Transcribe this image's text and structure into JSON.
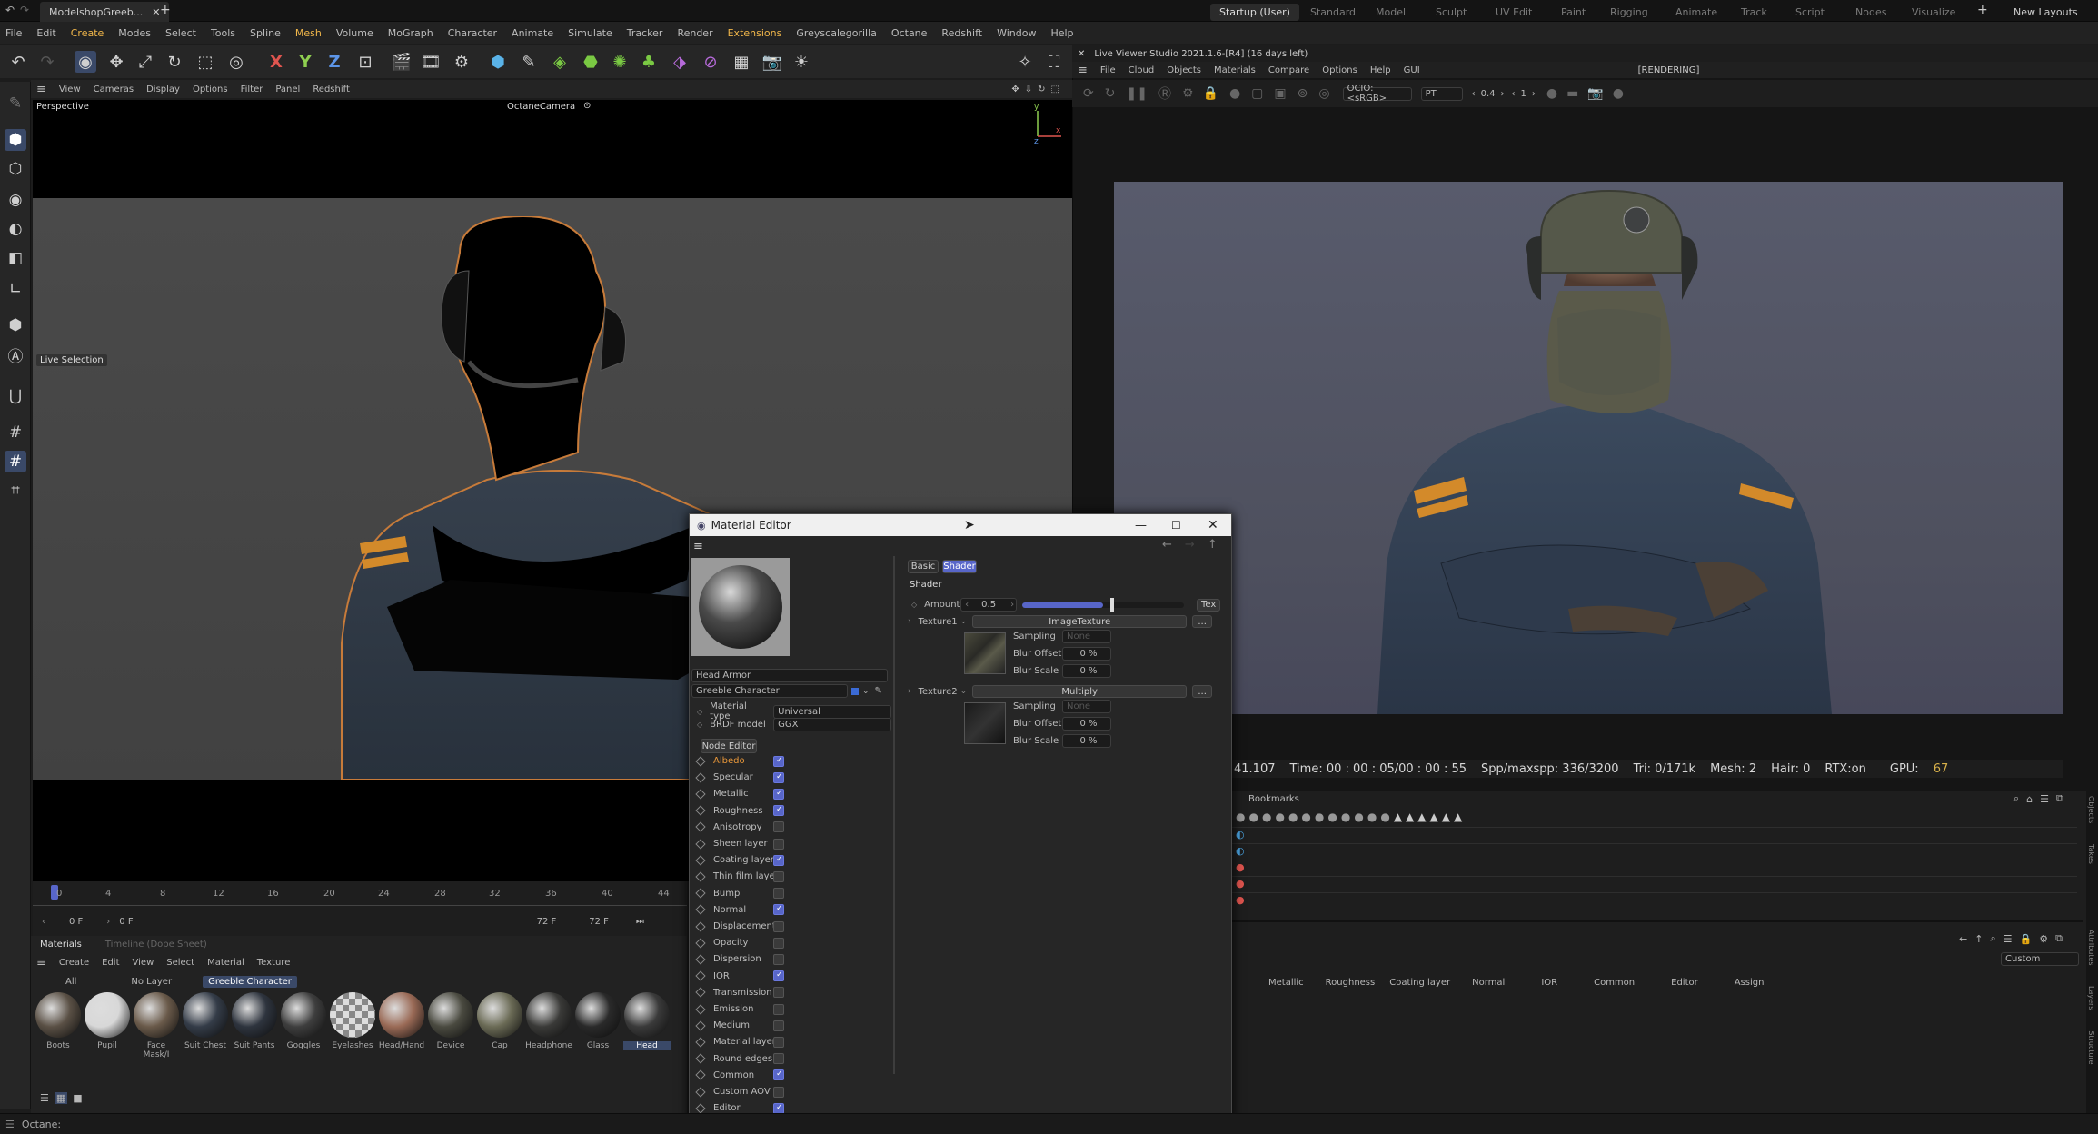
{
  "app": {
    "tab_title": "ModelshopGreeb...",
    "layouts": [
      "Startup (User)",
      "Standard",
      "Model",
      "Sculpt",
      "UV Edit",
      "Paint",
      "Rigging",
      "Animate",
      "Track",
      "Script",
      "Nodes",
      "Visualize"
    ],
    "active_layout": "Startup (User)",
    "new_layouts": "New Layouts"
  },
  "menu": [
    "File",
    "Edit",
    "Create",
    "Modes",
    "Select",
    "Tools",
    "Spline",
    "Mesh",
    "Volume",
    "MoGraph",
    "Character",
    "Animate",
    "Simulate",
    "Tracker",
    "Render",
    "Extensions",
    "Greyscalegorilla",
    "Octane",
    "Redshift",
    "Window",
    "Help"
  ],
  "viewport": {
    "menu": [
      "View",
      "Cameras",
      "Display",
      "Options",
      "Filter",
      "Panel",
      "Redshift"
    ],
    "label": "Perspective",
    "camera": "OctaneCamera",
    "tool_label": "Live Selection"
  },
  "timeline": {
    "ticks": [
      "0",
      "4",
      "8",
      "12",
      "16",
      "20",
      "24",
      "28",
      "32",
      "36",
      "40",
      "44"
    ],
    "start_frame": "0 F",
    "current_frame": "0 F",
    "end_frame": "72 F",
    "end_frame2": "72 F"
  },
  "materials": {
    "tabs": [
      "Materials",
      "Timeline (Dope Sheet)"
    ],
    "menu": [
      "Create",
      "Edit",
      "View",
      "Select",
      "Material",
      "Texture"
    ],
    "filters": [
      "All",
      "No Layer",
      "Greeble Character"
    ],
    "items": [
      "Boots",
      "Pupil",
      "Face Mask/I",
      "Suit Chest",
      "Suit Pants",
      "Goggles",
      "Eyelashes",
      "Head/Hand",
      "Device",
      "Cap",
      "Headphone",
      "Glass",
      "Head"
    ]
  },
  "live_viewer": {
    "title": "Live Viewer Studio 2021.1.6-[R4] (16 days left)",
    "menu": [
      "File",
      "Cloud",
      "Objects",
      "Materials",
      "Compare",
      "Options",
      "Help",
      "GUI"
    ],
    "state": "[RENDERING]",
    "ocio": "OCIO:<sRGB>",
    "mode": "PT",
    "zoom": "0.4",
    "num": "1",
    "status_prefix": "41.107",
    "status_time": "Time: 00 : 00 : 05/00 : 00 : 55",
    "status_spp": "Spp/maxspp: 336/3200",
    "status_tri": "Tri: 0/171k",
    "status_mesh": "Mesh: 2",
    "status_hair": "Hair: 0",
    "status_rtx": "RTX:on",
    "status_gpu": "GPU:",
    "status_gpu_val": "67"
  },
  "right_panel": {
    "bookmarks": "Bookmarks",
    "custom": "Custom",
    "columns": [
      "Metallic",
      "Roughness",
      "Coating layer",
      "Normal",
      "IOR",
      "Common",
      "Editor",
      "Assign"
    ],
    "side_tabs": [
      "Objects",
      "Takes",
      "Attributes",
      "Layers",
      "Structure"
    ]
  },
  "material_editor": {
    "title": "Material Editor",
    "mat_name": "Head Armor",
    "layer": "Greeble Character",
    "material_type_label": "Material type",
    "material_type": "Universal",
    "brdf_label": "BRDF model",
    "brdf": "GGX",
    "node_editor": "Node Editor",
    "channels": [
      {
        "name": "Albedo",
        "on": true
      },
      {
        "name": "Specular",
        "on": true
      },
      {
        "name": "Metallic",
        "on": true
      },
      {
        "name": "Roughness",
        "on": true
      },
      {
        "name": "Anisotropy",
        "on": false
      },
      {
        "name": "Sheen layer",
        "on": false
      },
      {
        "name": "Coating layer",
        "on": true
      },
      {
        "name": "Thin film layer",
        "on": false
      },
      {
        "name": "Bump",
        "on": false
      },
      {
        "name": "Normal",
        "on": true
      },
      {
        "name": "Displacement",
        "on": false
      },
      {
        "name": "Opacity",
        "on": false
      },
      {
        "name": "Dispersion",
        "on": false
      },
      {
        "name": "IOR",
        "on": true
      },
      {
        "name": "Transmission",
        "on": false
      },
      {
        "name": "Emission",
        "on": false
      },
      {
        "name": "Medium",
        "on": false
      },
      {
        "name": "Material layer",
        "on": false
      },
      {
        "name": "Round edges",
        "on": false
      },
      {
        "name": "Common",
        "on": true
      },
      {
        "name": "Custom AOV",
        "on": false
      },
      {
        "name": "Editor",
        "on": true
      }
    ],
    "tabs": [
      "Basic",
      "Shader"
    ],
    "section": "Shader",
    "amount_label": "Amount",
    "amount": "0.5",
    "amount_fill": 0.5,
    "tex_btn": "Tex",
    "texture1_label": "Texture1",
    "texture1": "ImageTexture",
    "texture2_label": "Texture2",
    "texture2": "Multiply",
    "sampling_label": "Sampling",
    "sampling": "None",
    "blur_offset_label": "Blur Offset",
    "blur_offset": "0 %",
    "blur_scale_label": "Blur Scale",
    "blur_scale": "0 %",
    "more": "..."
  },
  "statusbar": {
    "text": "Octane:"
  }
}
